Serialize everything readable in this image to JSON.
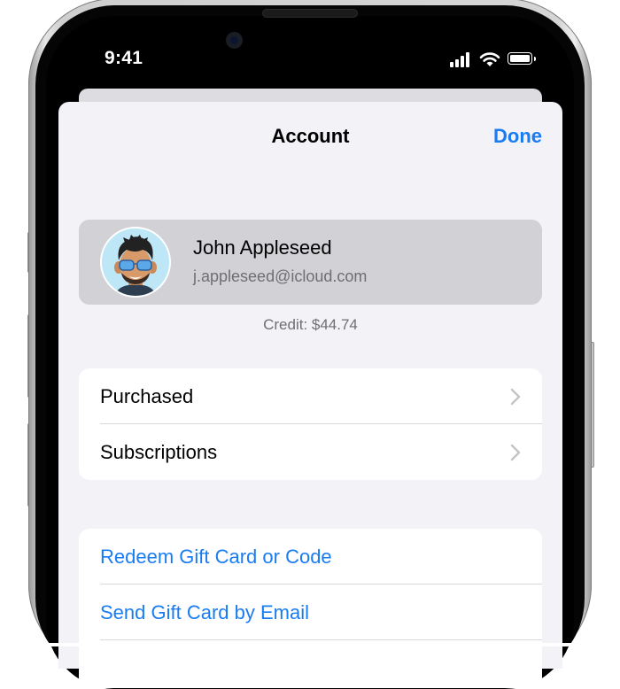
{
  "status_bar": {
    "time": "9:41"
  },
  "sheet": {
    "title": "Account",
    "done_label": "Done"
  },
  "account": {
    "name": "John Appleseed",
    "email": "j.appleseed@icloud.com",
    "avatar_icon": "memoji-avatar",
    "credit": "Credit: $44.74"
  },
  "groups": {
    "library": {
      "rows": [
        {
          "label": "Purchased"
        },
        {
          "label": "Subscriptions"
        }
      ]
    },
    "gifts": {
      "rows": [
        {
          "label": "Redeem Gift Card or Code"
        },
        {
          "label": "Send Gift Card by Email"
        }
      ]
    }
  },
  "colors": {
    "accent": "#1a7cf2",
    "sheet_background": "#f2f2f7",
    "account_card": "#d1d1d6",
    "secondary_text": "#6e6e73"
  },
  "icons": {
    "chevron": "chevron-right-icon",
    "signal": "cellular-signal-icon",
    "wifi": "wifi-icon",
    "battery": "battery-icon"
  }
}
